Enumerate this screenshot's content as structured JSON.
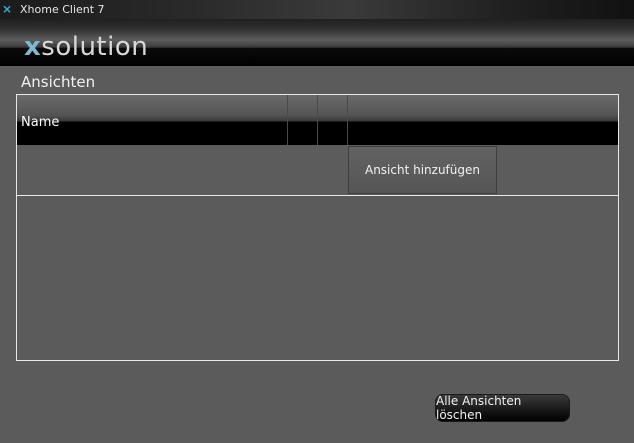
{
  "window": {
    "title": "Xhome Client 7",
    "icon": "xhome-x-icon"
  },
  "banner": {
    "logo_accent": "x",
    "logo_rest": "solution"
  },
  "views": {
    "section_title": "Ansichten",
    "table": {
      "columns": [
        "Name",
        "",
        "",
        ""
      ],
      "rows": [
        {
          "name": "",
          "action_label": "Ansicht hinzufügen"
        }
      ]
    },
    "delete_all_label": "Alle Ansichten löschen"
  },
  "colors": {
    "background": "#5b5b5b",
    "logo_accent": "#7fb6d0",
    "titlebar_icon": "#3fa7d6"
  }
}
